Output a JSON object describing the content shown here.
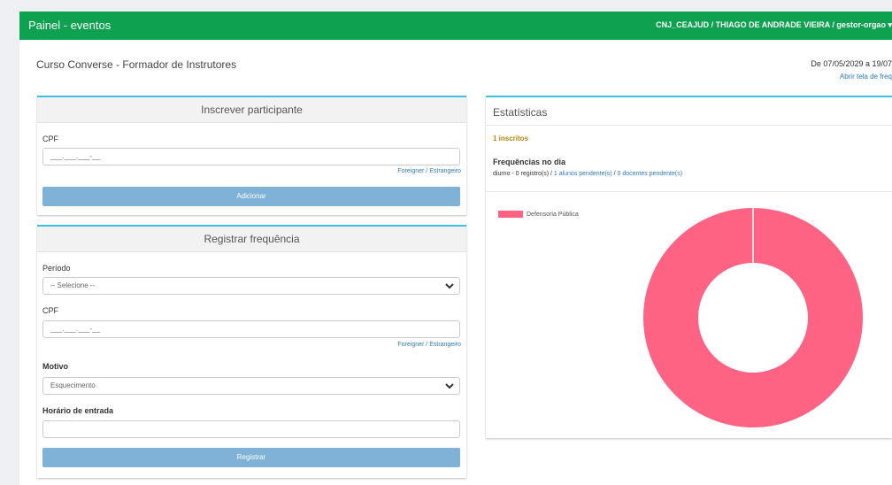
{
  "header": {
    "title": "Painel - eventos",
    "user": "CNJ_CEAJUD / THIAGO DE ANDRADE VIEIRA / gestor-orgao",
    "dropdown_icon": "chevron-down-icon"
  },
  "course": {
    "title": "Curso Converse - Formador de Instrutores",
    "date_range": "De 07/05/2029 a 19/07",
    "open_link": "Abrir tela de freq"
  },
  "enroll": {
    "heading": "Inscrever participante",
    "cpf_label": "CPF",
    "cpf_placeholder": "___.___.___-__",
    "foreigner_link": "Foreigner / Estrangeiro",
    "add_button": "Adicionar"
  },
  "attendance": {
    "heading": "Registrar frequência",
    "period_label": "Período",
    "period_value": "-- Selecione --",
    "cpf_label": "CPF",
    "cpf_placeholder": "___.___.___-__",
    "foreigner_link": "Foreigner / Estrangeiro",
    "reason_label": "Motivo",
    "reason_value": "Esquecimento",
    "entry_time_label": "Horário de entrada",
    "entry_time_value": "",
    "register_button": "Registrar"
  },
  "stats": {
    "heading": "Estatísticas",
    "enrolled": "1 inscritos",
    "freq_title": "Frequências no dia",
    "freq_prefix": "diurno - 0 registro(s) / ",
    "freq_students": "1 alunos pendente(s)",
    "freq_sep": " / ",
    "freq_teachers": "0 docentes pendente(s)"
  },
  "chart_data": {
    "type": "pie",
    "title": "",
    "labels": [
      "Defensoria Pública"
    ],
    "values": [
      1
    ],
    "colors": [
      "#ff6384"
    ],
    "donut": true,
    "legend_position": "top-left"
  }
}
